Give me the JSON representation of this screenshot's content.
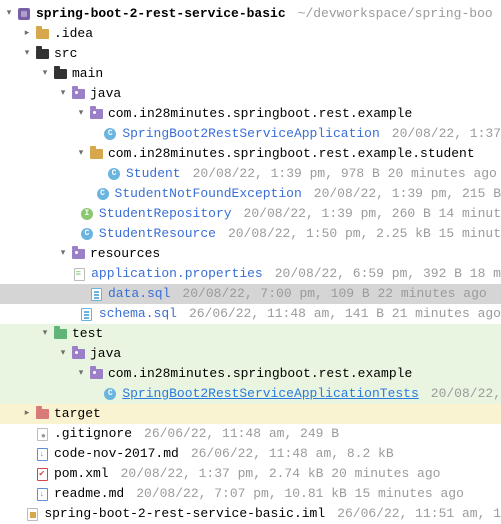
{
  "rows": [
    {
      "depth": 0,
      "chev": "down",
      "icon": "module",
      "name": "spring-boot-2-rest-service-basic",
      "bold": true,
      "meta": "~/devworkspace/spring-boo"
    },
    {
      "depth": 1,
      "chev": "right",
      "icon": "folder-res",
      "name": ".idea"
    },
    {
      "depth": 1,
      "chev": "down",
      "icon": "folder-dark",
      "name": "src"
    },
    {
      "depth": 2,
      "chev": "down",
      "icon": "folder-dark",
      "name": "main"
    },
    {
      "depth": 3,
      "chev": "down",
      "icon": "folder-pkg",
      "name": "java"
    },
    {
      "depth": 4,
      "chev": "down",
      "icon": "folder-pkg",
      "name": "com.in28minutes.springboot.rest.example"
    },
    {
      "depth": 5,
      "chev": "",
      "icon": "class",
      "name": "SpringBoot2RestServiceApplication",
      "blue": true,
      "meta": "20/08/22, 1:37"
    },
    {
      "depth": 4,
      "chev": "down",
      "icon": "folder-res",
      "name": "com.in28minutes.springboot.rest.example.student"
    },
    {
      "depth": 5,
      "chev": "",
      "icon": "class",
      "name": "Student",
      "blue": true,
      "meta": "20/08/22, 1:39 pm, 978 B 20 minutes ago"
    },
    {
      "depth": 5,
      "chev": "",
      "icon": "class",
      "name": "StudentNotFoundException",
      "blue": true,
      "meta": "20/08/22, 1:39 pm, 215 B"
    },
    {
      "depth": 5,
      "chev": "",
      "icon": "iface",
      "name": "StudentRepository",
      "blue": true,
      "meta": "20/08/22, 1:39 pm, 260 B 14 minut"
    },
    {
      "depth": 5,
      "chev": "",
      "icon": "class",
      "name": "StudentResource",
      "blue": true,
      "meta": "20/08/22, 1:50 pm, 2.25 kB 15 minut"
    },
    {
      "depth": 3,
      "chev": "down",
      "icon": "folder-pkg",
      "name": "resources"
    },
    {
      "depth": 4,
      "chev": "",
      "icon": "file-props",
      "name": "application.properties",
      "blue": true,
      "meta": "20/08/22, 6:59 pm, 392 B 18 m"
    },
    {
      "depth": 4,
      "chev": "",
      "icon": "file-sql",
      "name": "data.sql",
      "blue": true,
      "meta": "20/08/22, 7:00 pm, 109 B 22 minutes ago",
      "selected": true
    },
    {
      "depth": 4,
      "chev": "",
      "icon": "file-sql",
      "name": "schema.sql",
      "blue": true,
      "meta": "26/06/22, 11:48 am, 141 B 21 minutes ago"
    },
    {
      "depth": 2,
      "chev": "down",
      "icon": "folder-test",
      "name": "test",
      "highlight": true
    },
    {
      "depth": 3,
      "chev": "down",
      "icon": "folder-pkg",
      "name": "java",
      "highlight": true
    },
    {
      "depth": 4,
      "chev": "down",
      "icon": "folder-pkg",
      "name": "com.in28minutes.springboot.rest.example",
      "highlight": true
    },
    {
      "depth": 5,
      "chev": "",
      "icon": "class",
      "name": "SpringBoot2RestServiceApplicationTests",
      "link": true,
      "meta": "20/08/22,",
      "highlight": true
    },
    {
      "depth": 1,
      "chev": "right",
      "icon": "folder-red",
      "name": "target",
      "highlight_target": true
    },
    {
      "depth": 1,
      "chev": "",
      "icon": "file-git",
      "name": ".gitignore",
      "meta": "26/06/22, 11:48 am, 249 B"
    },
    {
      "depth": 1,
      "chev": "",
      "icon": "file-md",
      "name": "code-nov-2017.md",
      "meta": "26/06/22, 11:48 am, 8.2 kB"
    },
    {
      "depth": 1,
      "chev": "",
      "icon": "file-red",
      "name": "pom.xml",
      "meta": "20/08/22, 1:37 pm, 2.74 kB 20 minutes ago"
    },
    {
      "depth": 1,
      "chev": "",
      "icon": "file-md",
      "name": "readme.md",
      "meta": "20/08/22, 7:07 pm, 10.81 kB 15 minutes ago"
    },
    {
      "depth": 1,
      "chev": "",
      "icon": "file-iml",
      "name": "spring-boot-2-rest-service-basic.iml",
      "meta": "26/06/22, 11:51 am, 1"
    }
  ]
}
